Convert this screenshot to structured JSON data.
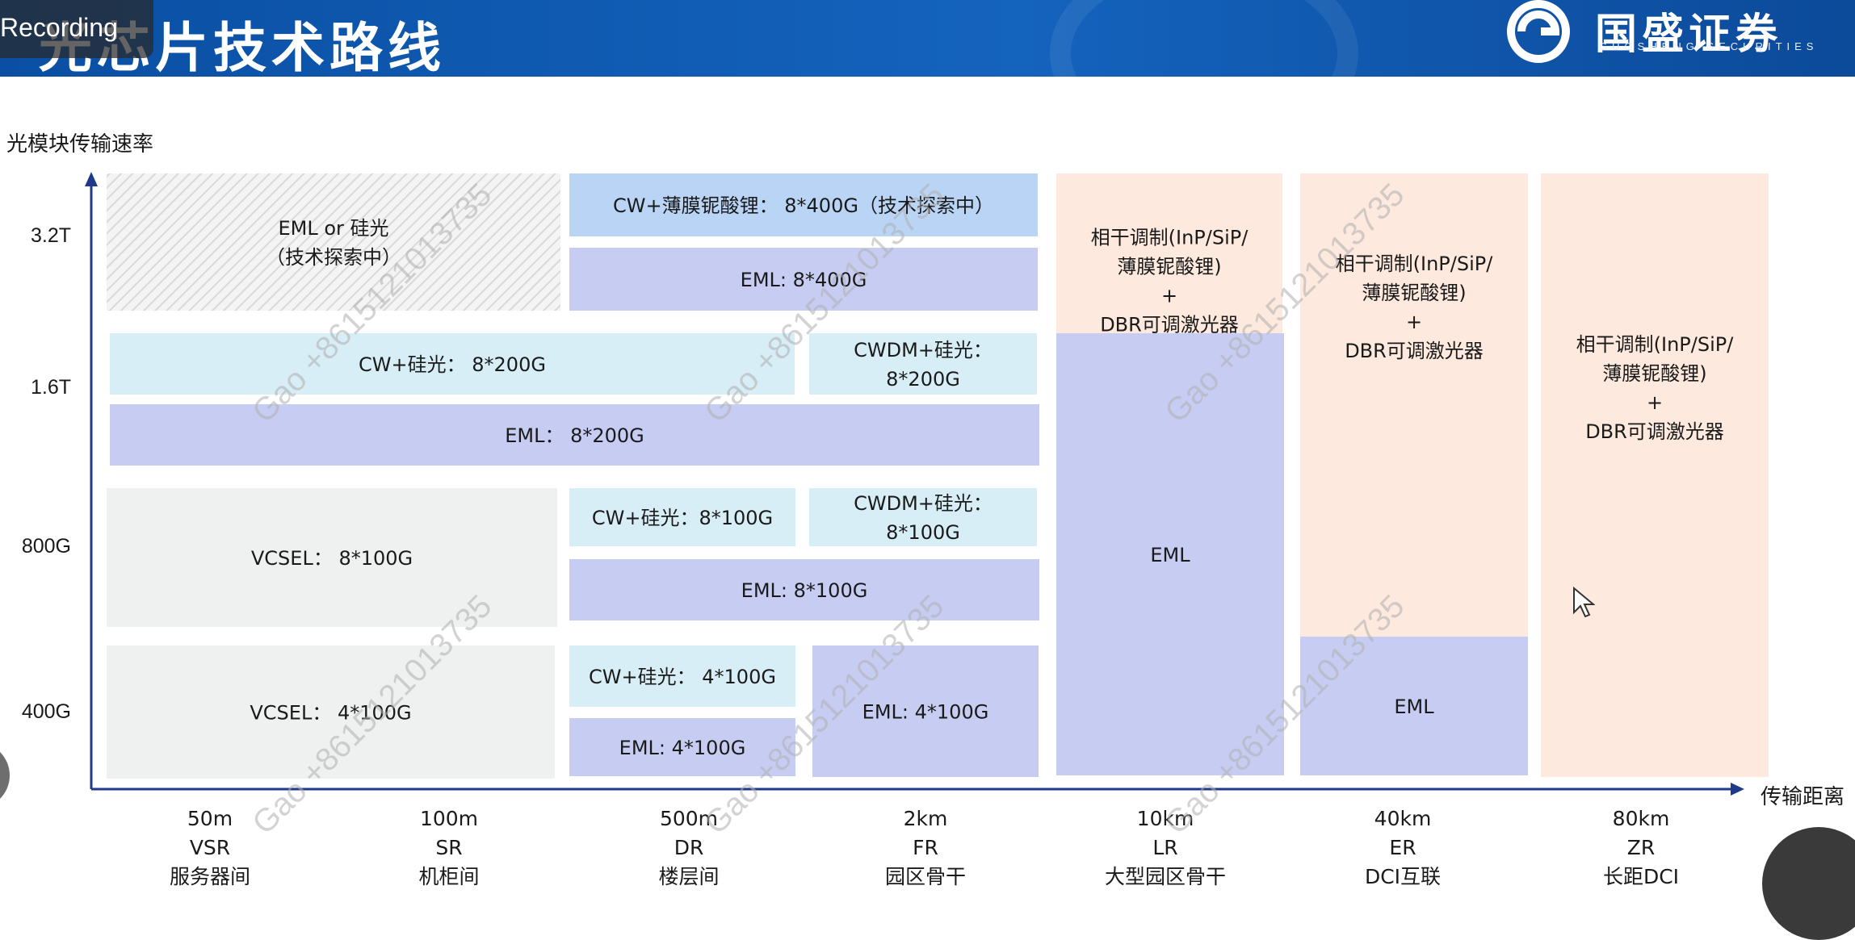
{
  "header": {
    "title": "光芯片技术路线",
    "brand": "国盛证券",
    "brand_sub": "GUOSHENG SECURITIES",
    "recording_label": "Recording"
  },
  "watermark": "Gao +8615121013735",
  "colors": {
    "header_bg": "#0a4fa3",
    "hatch": "#e6e6e6",
    "light_blue": "#d8eef6",
    "lavender": "#c7cdf2",
    "peach": "#fde9dd",
    "mid_blue": "#b9d4f5",
    "gray": "#eef1f0"
  },
  "chart_data": {
    "type": "table",
    "ylabel": "光模块传输速率",
    "xlabel": "传输距离",
    "y_categories": [
      "400G",
      "800G",
      "1.6T",
      "3.2T"
    ],
    "x_categories": [
      {
        "distance": "50m",
        "code": "VSR",
        "name": "服务器间"
      },
      {
        "distance": "100m",
        "code": "SR",
        "name": "机柜间"
      },
      {
        "distance": "500m",
        "code": "DR",
        "name": "楼层间"
      },
      {
        "distance": "2km",
        "code": "FR",
        "name": "园区骨干"
      },
      {
        "distance": "10km",
        "code": "LR",
        "name": "大型园区骨干"
      },
      {
        "distance": "40km",
        "code": "ER",
        "name": "DCI互联"
      },
      {
        "distance": "80km",
        "code": "ZR",
        "name": "长距DCI"
      }
    ],
    "blocks": [
      {
        "id": "eml-or-sip-3t2",
        "lines": [
          "EML or 硅光",
          "（技术探索中）"
        ],
        "rate": "3.2T",
        "from": "50m",
        "to": "100m",
        "style": "hatch"
      },
      {
        "id": "cw-tfln-3t2",
        "lines": [
          "CW+薄膜铌酸锂： 8*400G（技术探索中）"
        ],
        "rate": "3.2T",
        "from": "500m",
        "to": "2km",
        "style": "mid_blue"
      },
      {
        "id": "eml-3t2",
        "lines": [
          "EML: 8*400G"
        ],
        "rate": "3.2T",
        "from": "500m",
        "to": "2km",
        "style": "lavender"
      },
      {
        "id": "coherent-lr",
        "lines": [
          "相干调制(InP/SiP/",
          "薄膜铌酸锂)",
          "+",
          "DBR可调激光器"
        ],
        "rate": "3.2T",
        "from": "10km",
        "to": "10km",
        "style": "peach"
      },
      {
        "id": "cw-sip-1t6",
        "lines": [
          "CW+硅光： 8*200G"
        ],
        "rate": "1.6T",
        "from": "50m",
        "to": "500m",
        "style": "light_blue"
      },
      {
        "id": "cwdm-sip-1t6",
        "lines": [
          "CWDM+硅光：",
          "8*200G"
        ],
        "rate": "1.6T",
        "from": "2km",
        "to": "2km",
        "style": "light_blue"
      },
      {
        "id": "eml-1t6",
        "lines": [
          "EML： 8*200G"
        ],
        "rate": "1.6T",
        "from": "50m",
        "to": "2km",
        "style": "lavender"
      },
      {
        "id": "eml-lr",
        "lines": [
          "EML"
        ],
        "rate": "400G-1.6T",
        "from": "10km",
        "to": "10km",
        "style": "lavender"
      },
      {
        "id": "coherent-er",
        "lines": [
          "相干调制(InP/SiP/",
          "薄膜铌酸锂)",
          "+",
          "DBR可调激光器"
        ],
        "rate": "800G-3.2T",
        "from": "40km",
        "to": "40km",
        "style": "peach"
      },
      {
        "id": "eml-er",
        "lines": [
          "EML"
        ],
        "rate": "400G",
        "from": "40km",
        "to": "40km",
        "style": "lavender"
      },
      {
        "id": "coherent-zr",
        "lines": [
          "相干调制(InP/SiP/",
          "薄膜铌酸锂)",
          "+",
          "DBR可调激光器"
        ],
        "rate": "400G-3.2T",
        "from": "80km",
        "to": "80km",
        "style": "peach"
      },
      {
        "id": "vcsel-800g",
        "lines": [
          "VCSEL： 8*100G"
        ],
        "rate": "800G",
        "from": "50m",
        "to": "100m",
        "style": "gray"
      },
      {
        "id": "cw-sip-800g",
        "lines": [
          "CW+硅光：8*100G"
        ],
        "rate": "800G",
        "from": "500m",
        "to": "500m",
        "style": "light_blue"
      },
      {
        "id": "cwdm-sip-800g",
        "lines": [
          "CWDM+硅光：",
          "8*100G"
        ],
        "rate": "800G",
        "from": "2km",
        "to": "2km",
        "style": "light_blue"
      },
      {
        "id": "eml-800g",
        "lines": [
          "EML: 8*100G"
        ],
        "rate": "800G",
        "from": "500m",
        "to": "2km",
        "style": "lavender"
      },
      {
        "id": "vcsel-400g",
        "lines": [
          "VCSEL： 4*100G"
        ],
        "rate": "400G",
        "from": "50m",
        "to": "100m",
        "style": "gray"
      },
      {
        "id": "cw-sip-400g",
        "lines": [
          "CW+硅光： 4*100G"
        ],
        "rate": "400G",
        "from": "500m",
        "to": "500m",
        "style": "light_blue"
      },
      {
        "id": "eml-400g-dr",
        "lines": [
          "EML: 4*100G"
        ],
        "rate": "400G",
        "from": "500m",
        "to": "500m",
        "style": "lavender"
      },
      {
        "id": "eml-400g-fr",
        "lines": [
          "EML: 4*100G"
        ],
        "rate": "400G",
        "from": "2km",
        "to": "2km",
        "style": "lavender"
      }
    ]
  }
}
